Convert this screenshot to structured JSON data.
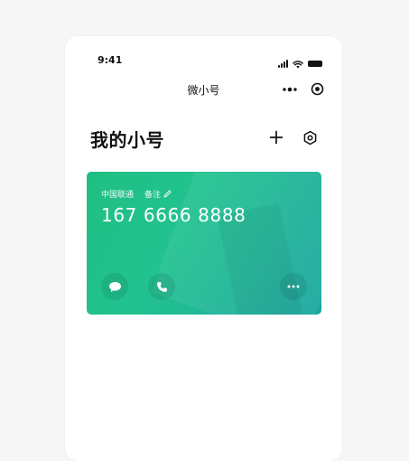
{
  "status_bar": {
    "time": "9:41"
  },
  "nav": {
    "title": "微小号"
  },
  "header": {
    "title": "我的小号"
  },
  "card": {
    "carrier": "中国联通",
    "remark_label": "备注",
    "number": "167 6666 8888"
  },
  "icons": {
    "more": "more-dots-icon",
    "target": "target-icon",
    "add": "plus-icon",
    "settings": "hexagon-settings-icon",
    "message": "message-bubble-icon",
    "call": "phone-icon",
    "card_more": "ellipsis-icon",
    "edit": "pencil-icon"
  },
  "colors": {
    "card_start": "#1fbf83",
    "card_end": "#1aa6a0",
    "text_primary": "#111111"
  }
}
